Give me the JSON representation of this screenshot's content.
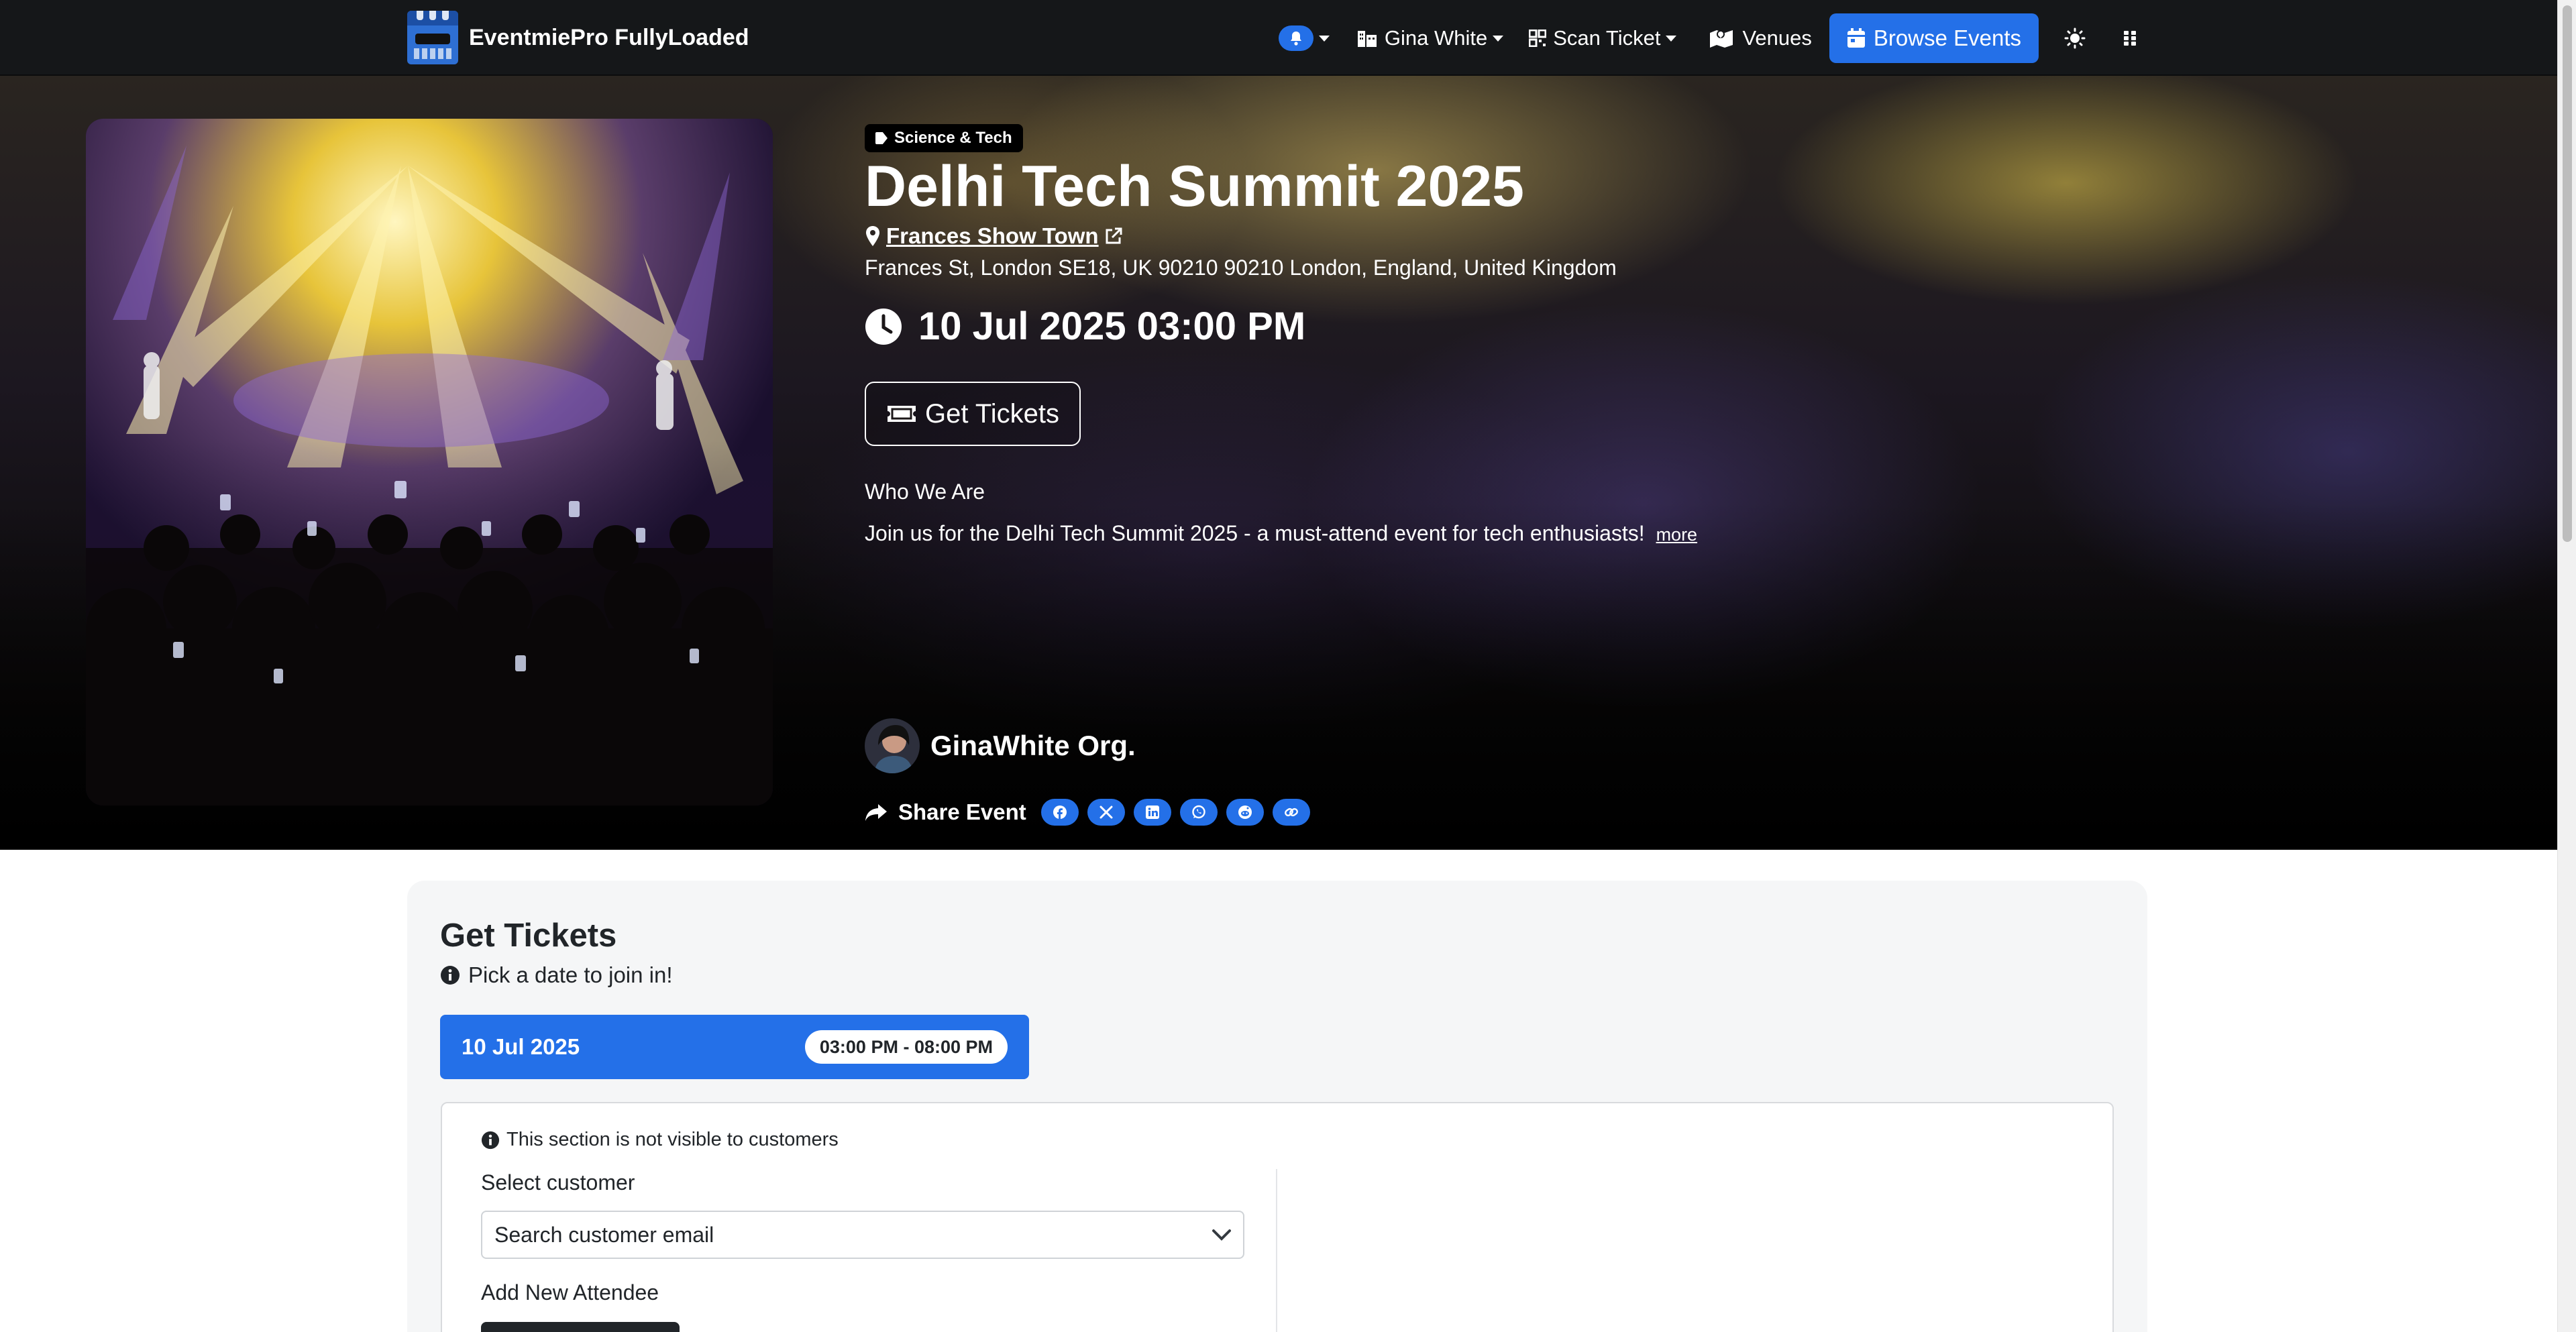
{
  "nav": {
    "brand": "EventmiePro FullyLoaded",
    "user": "Gina White",
    "scan": "Scan Ticket",
    "venues": "Venues",
    "browse": "Browse Events"
  },
  "event": {
    "category": "Science & Tech",
    "title": "Delhi Tech Summit 2025",
    "venue": "Frances Show Town",
    "address": "Frances St, London SE18, UK 90210 90210 London, England, United Kingdom",
    "datetime": "10 Jul 2025 03:00 PM",
    "get_tickets": "Get Tickets",
    "about_heading": "Who We Are",
    "description": "Join us for the Delhi Tech Summit 2025 - a must-attend event for tech enthusiasts!",
    "more": "more",
    "organizer": "GinaWhite Org.",
    "share_label": "Share Event"
  },
  "tickets": {
    "title": "Get Tickets",
    "subtitle": "Pick a date to join in!",
    "date": "10 Jul 2025",
    "time": "03:00 PM - 08:00 PM",
    "admin_note": "This section is not visible to customers",
    "select_label": "Select customer",
    "select_placeholder": "Search customer email",
    "add_label": "Add New Attendee"
  },
  "colors": {
    "accent": "#2470e8",
    "navbar": "#151719"
  },
  "icons": [
    "bell-icon",
    "venue-icon",
    "qr-icon",
    "map-icon",
    "calendar-icon",
    "theme-icon",
    "grid-icon",
    "tag-icon",
    "map-pin-icon",
    "external-link-icon",
    "clock-icon",
    "ticket-icon",
    "share-icon",
    "facebook-icon",
    "x-icon",
    "linkedin-icon",
    "whatsapp-icon",
    "reddit-icon",
    "link-icon",
    "info-icon",
    "chevron-down-icon"
  ]
}
